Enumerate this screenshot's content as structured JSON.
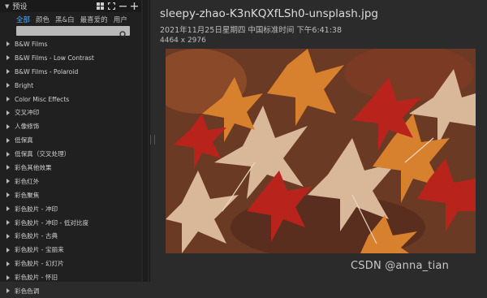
{
  "panel": {
    "title": "预设",
    "icons": [
      "grid-icon",
      "expand-icon",
      "minus-icon",
      "plus-icon"
    ],
    "tabs": [
      {
        "label": "全部",
        "active": true
      },
      {
        "label": "颜色",
        "active": false
      },
      {
        "label": "黑&白",
        "active": false
      },
      {
        "label": "最喜爱的",
        "active": false
      },
      {
        "label": "用户",
        "active": false
      }
    ],
    "search_placeholder": "",
    "items": [
      "B&W Films",
      "B&W Films - Low Contrast",
      "B&W Films - Polaroid",
      "Bright",
      "Color Misc Effects",
      "交叉冲印",
      "人像修饰",
      "低保真",
      "低保真（交叉处理）",
      "彩色其他效果",
      "彩色红外",
      "彩色聚焦",
      "彩色胶片 - 冲印",
      "彩色胶片 - 冲印 - 低对比度",
      "彩色胶片 - 古典",
      "彩色胶片 - 宝丽来",
      "彩色胶片 - 幻灯片",
      "彩色胶片 - 怀旧",
      "彩色色调"
    ]
  },
  "info": {
    "filename": "sleepy-zhao-K3nKQXfLSh0-unsplash.jpg",
    "date": "2021年11月25日星期四 中国标准时间 下午6:41:38",
    "dimensions": "4464 x 2976"
  },
  "watermark": "CSDN @anna_tian",
  "colors": {
    "accent": "#5aa9ff",
    "panel_bg": "#202020",
    "main_bg": "#2b2b2b"
  }
}
